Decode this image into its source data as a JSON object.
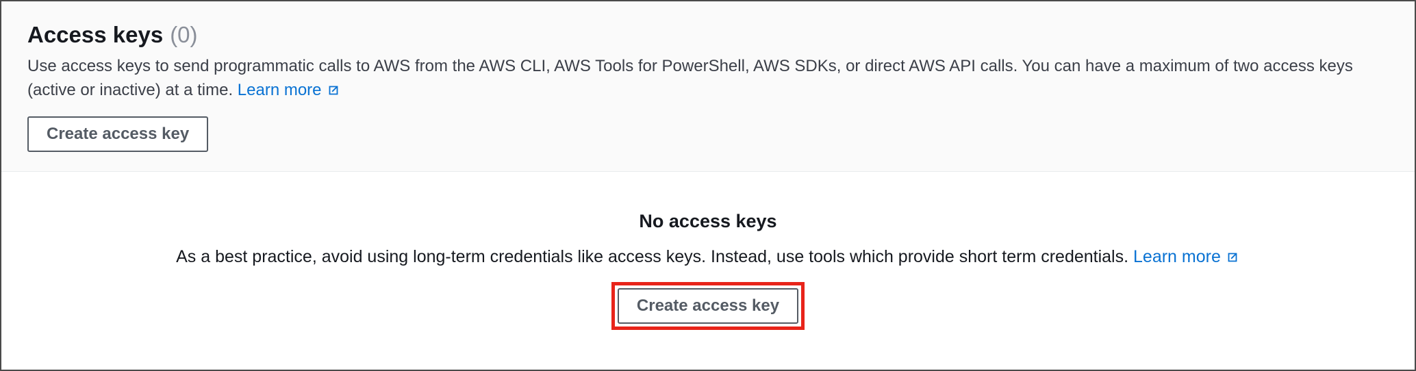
{
  "header": {
    "title": "Access keys",
    "count": "(0)",
    "description_prefix": "Use access keys to send programmatic calls to AWS from the AWS CLI, AWS Tools for PowerShell, AWS SDKs, or direct AWS API calls. You can have a maximum of two access keys (active or inactive) at a time. ",
    "learn_more_label": "Learn more",
    "create_button_label": "Create access key"
  },
  "empty_state": {
    "title": "No access keys",
    "description_prefix": "As a best practice, avoid using long-term credentials like access keys. Instead, use tools which provide short term credentials. ",
    "learn_more_label": "Learn more",
    "create_button_label": "Create access key"
  }
}
